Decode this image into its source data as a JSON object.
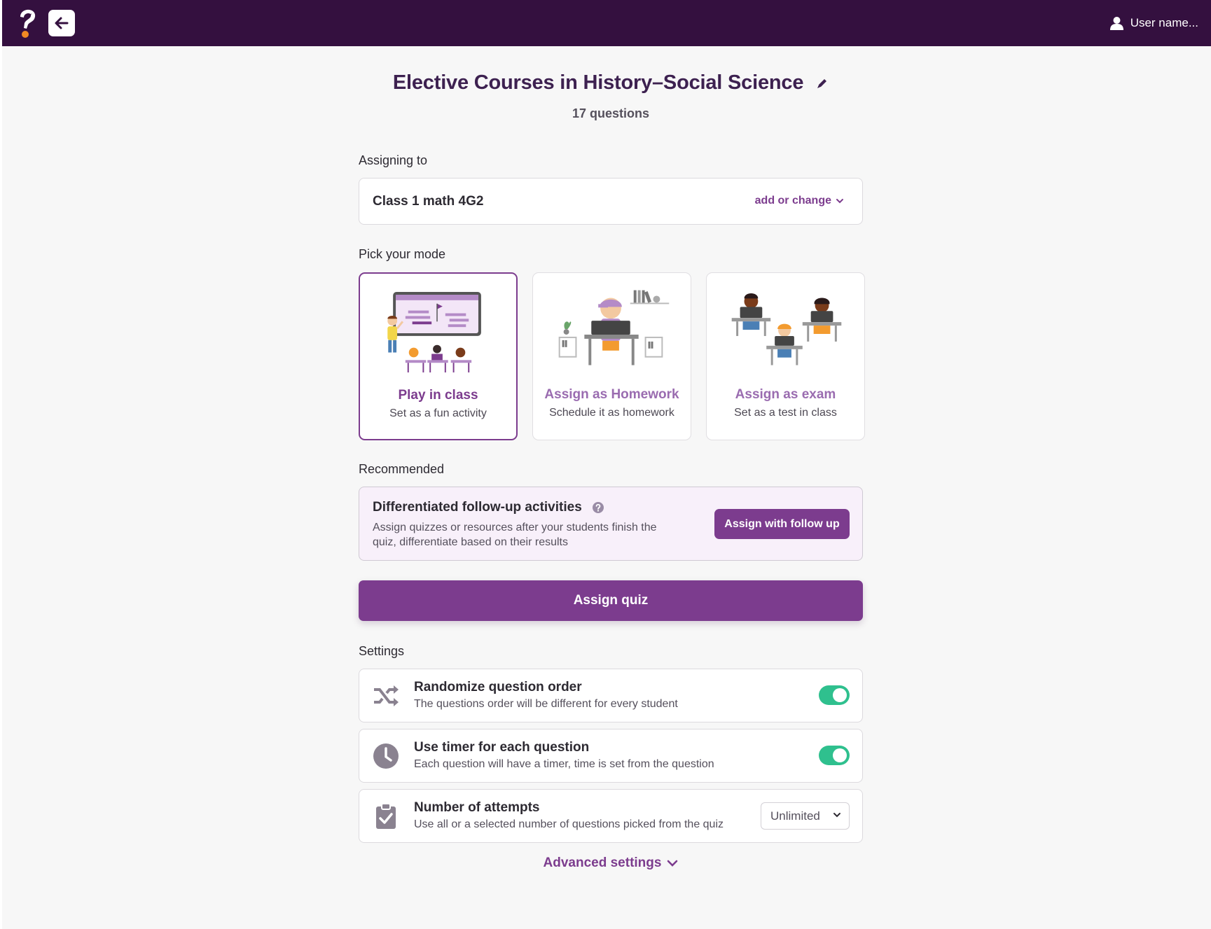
{
  "header": {
    "back_icon": "arrow-left-icon",
    "logo_icon": "quiz-logo-icon",
    "user_icon": "user-icon",
    "user_name": "User name..."
  },
  "quiz": {
    "title": "Elective Courses in History–Social Science",
    "question_count": "17 questions"
  },
  "assigning": {
    "label": "Assigning to",
    "class_name": "Class 1 math 4G2",
    "add_change": "add or change"
  },
  "mode": {
    "label": "Pick your mode",
    "cards": [
      {
        "title": "Play in class",
        "subtitle": "Set as a fun activity",
        "selected": true
      },
      {
        "title": "Assign as Homework",
        "subtitle": "Schedule it as homework",
        "selected": false
      },
      {
        "title": "Assign as exam",
        "subtitle": "Set as a test in class",
        "selected": false
      }
    ]
  },
  "recommended": {
    "label": "Recommended",
    "title": "Differentiated follow-up activities",
    "description": "Assign quizzes or resources after your students finish the quiz, differentiate based on their results",
    "button": "Assign with follow up"
  },
  "assign_button": "Assign quiz",
  "settings": {
    "label": "Settings",
    "items": [
      {
        "icon": "shuffle-icon",
        "title": "Randomize question order",
        "description": "The questions order will be different for every student",
        "enabled": true
      },
      {
        "icon": "clock-icon",
        "title": "Use timer for each question",
        "description": "Each question will have a timer, time is set from the question",
        "enabled": true
      },
      {
        "icon": "clipboard-check-icon",
        "title": "Number of attempts",
        "description": "Use all or a selected number of questions picked from the quiz",
        "value": "Unlimited"
      }
    ],
    "advanced": "Advanced settings"
  },
  "colors": {
    "topbar": "#34103f",
    "accent": "#7c3c8e",
    "toggle_on": "#2fc08e",
    "background": "#f7f7f7"
  }
}
